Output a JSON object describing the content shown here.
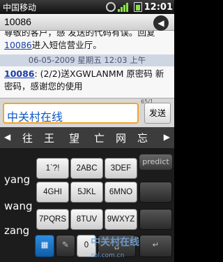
{
  "status_bar": {
    "carrier": "中国移动",
    "time": "12:01"
  },
  "header": {
    "title": "10086"
  },
  "conversation": {
    "prev_message_line1": "尊敬的客户，感 发送的代码有误。回复",
    "prev_message_link": "10086",
    "prev_message_line2": "进入短信营业厅。",
    "date_separator": "06-05-2009 星期五 12:03 上午",
    "current_sender": "10086",
    "current_message": ": (2/2)送XGWLANMM 原密码 新密码，感谢您的使用"
  },
  "compose": {
    "char_counter": "65/1",
    "text_value": "中关村在线",
    "send_label": "发送"
  },
  "candidates": {
    "items": [
      "往",
      "王",
      "望",
      "亡",
      "网",
      "忘"
    ],
    "left_arrow": "◀",
    "right_arrow": "▶"
  },
  "keyboard": {
    "side_candidates": [
      "yang",
      "wang",
      "zang"
    ],
    "predict_label": "predict",
    "keys": [
      [
        "1`?!",
        "2ABC",
        "3DEF"
      ],
      [
        "4GHI",
        "5JKL",
        "6MNO"
      ],
      [
        "7PQRS",
        "8TUV",
        "9WXYZ"
      ]
    ],
    "bottom_keys": {
      "grid": "▦",
      "mic": "✎",
      "zero": "0",
      "space": "␣",
      "enter": "↵"
    }
  },
  "watermark": {
    "main": "中关村在线",
    "sub": "zol.com.cn"
  }
}
